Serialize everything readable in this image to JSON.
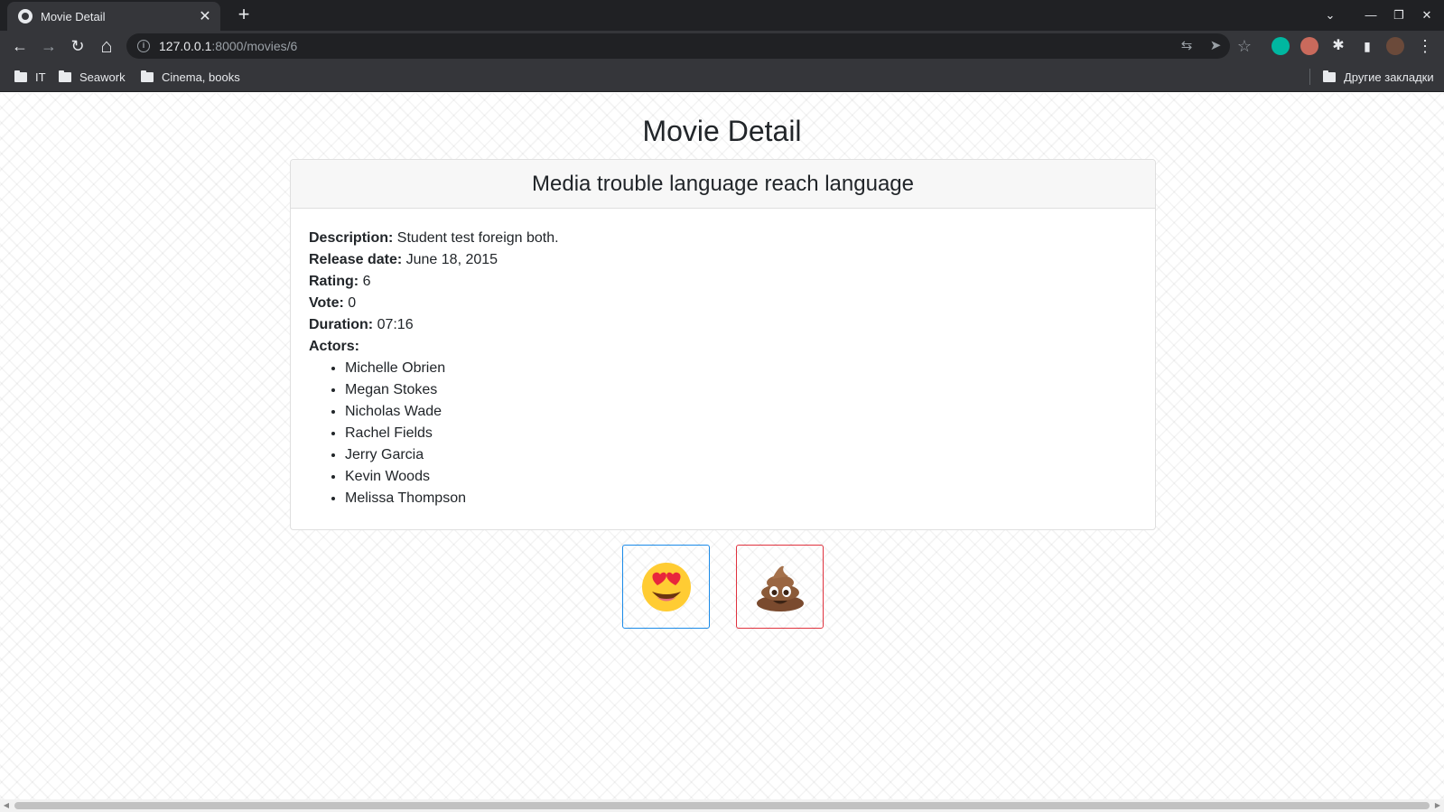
{
  "browser": {
    "tab_title": "Movie Detail",
    "tab_close": "✕",
    "new_tab": "+",
    "url_host": "127.0.0.1",
    "url_path": ":8000/movies/6",
    "bookmarks": [
      "IT",
      "Seawork",
      "Cinema, books"
    ],
    "other_bookmarks": "Другие закладки",
    "icons": {
      "back": "←",
      "forward": "→",
      "reload": "↻",
      "home": "⌂",
      "translate": "⇆",
      "send": "➤",
      "star": "☆",
      "puzzle": "✱",
      "sidebar": "▮",
      "menu": "⋮",
      "tab_search": "⌄",
      "minimize": "—",
      "restore": "❐",
      "close": "✕"
    }
  },
  "page": {
    "title": "Movie Detail",
    "movie": {
      "name": "Media trouble language reach language",
      "description_label": "Description:",
      "description": "Student test foreign both.",
      "release_label": "Release date:",
      "release_date": "June 18, 2015",
      "rating_label": "Rating:",
      "rating": "6",
      "vote_label": "Vote:",
      "vote": "0",
      "duration_label": "Duration:",
      "duration": "07:16",
      "actors_label": "Actors:",
      "actors": [
        "Michelle Obrien",
        "Megan Stokes",
        "Nicholas Wade",
        "Rachel Fields",
        "Jerry Garcia",
        "Kevin Woods",
        "Melissa Thompson"
      ]
    },
    "vote_buttons": {
      "like_icon": "heart-eyes-emoji",
      "dislike_icon": "poop-emoji",
      "like_border": "#1a8ae8",
      "dislike_border": "#e0323e"
    }
  }
}
